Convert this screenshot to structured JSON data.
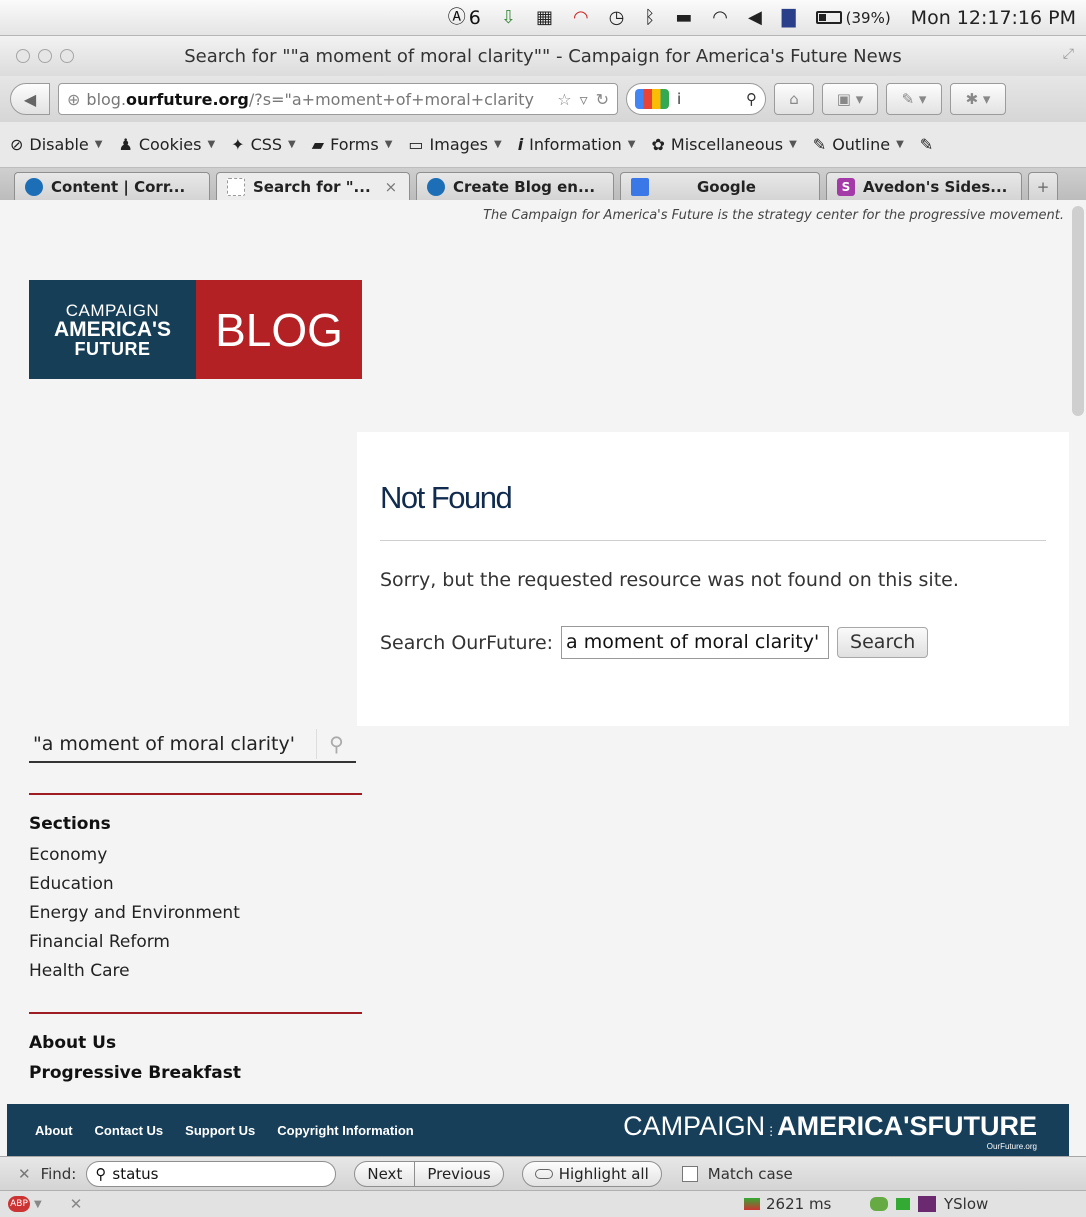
{
  "menubar": {
    "adobe_badge": "6",
    "battery": "(39%)",
    "clock": "Mon 12:17:16 PM"
  },
  "window": {
    "title": "Search for \"\"a moment of moral clarity\"\" - Campaign for America's Future News"
  },
  "navbar": {
    "url_host_prefix": "blog.",
    "url_host_domain": "ourfuture.org",
    "url_path": "/?s=\"a+moment+of+moral+clarity",
    "search_value": "i"
  },
  "devbar": {
    "items": [
      "Disable",
      "Cookies",
      "CSS",
      "Forms",
      "Images",
      "Information",
      "Miscellaneous",
      "Outline"
    ]
  },
  "tabs": [
    {
      "label": "Content | Corr..."
    },
    {
      "label": "Search for \"..."
    },
    {
      "label": "Create Blog en..."
    },
    {
      "label": "Google"
    },
    {
      "label": "Avedon's Sides..."
    }
  ],
  "page": {
    "tagline": "The Campaign for America's Future is the strategy center for the progressive movement.",
    "logo": {
      "line1": "CAMPAIGN",
      "line2": "AMERICA'S",
      "line3": "FUTURE",
      "blog": "BLOG"
    },
    "main": {
      "title": "Not Found",
      "message": "Sorry, but the requested resource was not found on this site.",
      "search_label": "Search OurFuture:",
      "search_value": "a moment of moral clarity'",
      "search_button": "Search"
    },
    "sidebar": {
      "search_value": "\"a moment of moral clarity'",
      "sections_title": "Sections",
      "sections": [
        "Economy",
        "Education",
        "Energy and Environment",
        "Financial Reform",
        "Health Care"
      ],
      "about": "About Us",
      "breakfast": "Progressive Breakfast"
    },
    "footer": {
      "links": [
        "About",
        "Contact Us",
        "Support Us",
        "Copyright Information"
      ],
      "logo_light": "CAMPAIGN",
      "logo_bold": "AMERICA'SFUTURE",
      "logo_sub": "OurFuture.org"
    }
  },
  "findbar": {
    "label": "Find:",
    "value": "status",
    "next": "Next",
    "previous": "Previous",
    "highlight": "Highlight all",
    "match_case": "Match case"
  },
  "statusbar": {
    "load_time": "2621 ms",
    "yslow": "YSlow"
  }
}
